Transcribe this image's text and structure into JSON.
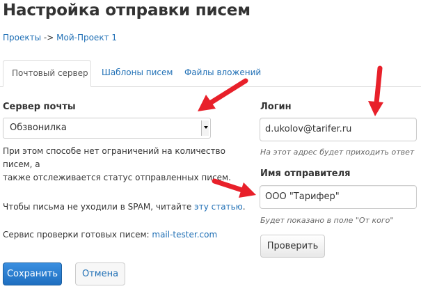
{
  "page": {
    "title": "Настройка отправки писем"
  },
  "breadcrumb": {
    "projects": "Проекты",
    "separator": "->",
    "project": "Мой-Проект 1"
  },
  "tabs": [
    {
      "label": "Почтовый сервер",
      "active": true
    },
    {
      "label": "Шаблоны писем",
      "active": false
    },
    {
      "label": "Файлы вложений",
      "active": false
    }
  ],
  "server": {
    "label": "Сервер почты",
    "selected": "Обзвонилка",
    "desc_line1": "При этом способе нет ограничений на количество писем, а",
    "desc_line2": "также отслеживается статус отправленных писем.",
    "spam_text": "Чтобы письма не уходили в SPAM, читайте ",
    "spam_link": "эту статью",
    "spam_end": ".",
    "tester_text": "Сервис проверки готовых писем: ",
    "tester_link": "mail-tester.com"
  },
  "login": {
    "label": "Логин",
    "value": "d.ukolov@tarifer.ru",
    "hint": "На этот адрес будет приходить ответ"
  },
  "sender": {
    "label": "Имя отправителя",
    "value": "ООО \"Тарифер\"",
    "hint": "Будет показано в поле \"От кого\""
  },
  "buttons": {
    "check": "Проверить",
    "save": "Сохранить",
    "cancel": "Отмена"
  },
  "colors": {
    "link": "#1f6fb5",
    "primary": "#2a7fd4",
    "arrow": "#e8202a"
  }
}
